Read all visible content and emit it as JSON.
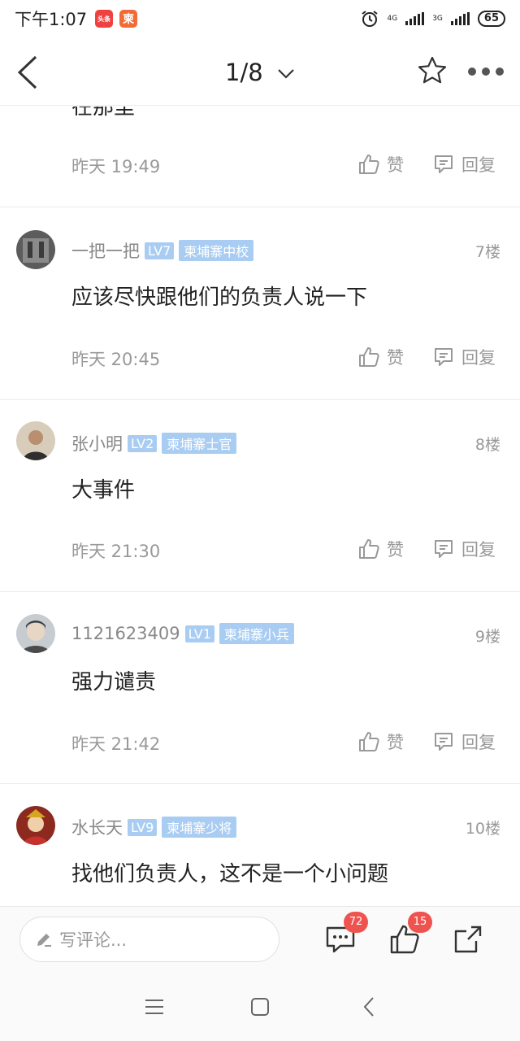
{
  "status_bar": {
    "time": "下午1:07",
    "app_badge_1": "头条",
    "app_badge_2": "柬",
    "network_1": "4G",
    "network_2": "3G",
    "battery": "65"
  },
  "nav": {
    "title": "1/8"
  },
  "partial_text": "在那里",
  "first_comment": {
    "time": "昨天 19:49",
    "like_label": "赞",
    "reply_label": "回复"
  },
  "comments": [
    {
      "author": "一把一把",
      "level": "LV7",
      "rank": "柬埔寨中校",
      "floor": "7楼",
      "text": "应该尽快跟他们的负责人说一下",
      "time": "昨天 20:45",
      "like_label": "赞",
      "reply_label": "回复",
      "avatar_color": "#6b6b6b"
    },
    {
      "author": "张小明",
      "level": "LV2",
      "rank": "柬埔寨士官",
      "floor": "8楼",
      "text": "大事件",
      "time": "昨天 21:30",
      "like_label": "赞",
      "reply_label": "回复",
      "avatar_color": "#c9b59a"
    },
    {
      "author": "1121623409",
      "level": "LV1",
      "rank": "柬埔寨小兵",
      "floor": "9楼",
      "text": "强力谴责",
      "time": "昨天 21:42",
      "like_label": "赞",
      "reply_label": "回复",
      "avatar_color": "#9aa0a6"
    },
    {
      "author": "水长天",
      "level": "LV9",
      "rank": "柬埔寨少将",
      "floor": "10楼",
      "text": "找他们负责人，这不是一个小问题",
      "avatar_color": "#b23a2e"
    }
  ],
  "bottom_bar": {
    "input_placeholder": "写评论...",
    "comment_count": "72",
    "like_count": "15"
  },
  "colors": {
    "tag_bg": "#a9cdf2",
    "badge_red": "#ef5350",
    "muted_text": "#999999"
  }
}
